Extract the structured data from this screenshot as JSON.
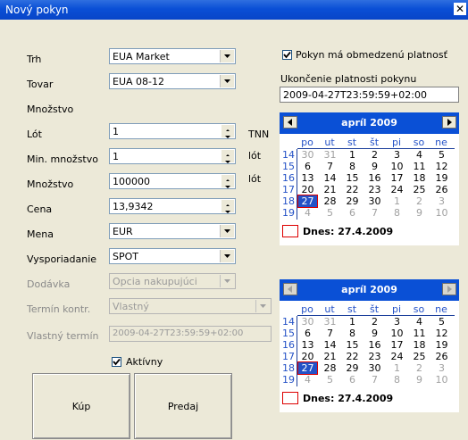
{
  "window": {
    "title": "Nový pokyn",
    "close_glyph": "✕"
  },
  "form": {
    "trh": {
      "label": "Trh",
      "value": "EUA Market"
    },
    "tovar": {
      "label": "Tovar",
      "value": "EUA 08-12"
    },
    "mnozstvo_header": "Množstvo",
    "lot": {
      "label": "Lót",
      "value": "1",
      "unit": "TNN"
    },
    "min_mnozstvo": {
      "label": "Min. množstvo",
      "value": "1",
      "unit": "lót"
    },
    "mnozstvo": {
      "label": "Množstvo",
      "value": "100000",
      "unit": "lót"
    },
    "cena": {
      "label": "Cena",
      "value": "13,9342"
    },
    "mena": {
      "label": "Mena",
      "value": "EUR"
    },
    "vysporiadanie": {
      "label": "Vysporiadanie",
      "value": "SPOT"
    },
    "dodavka": {
      "label": "Dodávka",
      "value": "Opcia nakupujúci"
    },
    "termin_kontr": {
      "label": "Termín kontr.",
      "value": "Vlastný"
    },
    "vlastny_termin": {
      "label": "Vlastný termín",
      "value": "2009-04-27T23:59:59+02:00"
    },
    "aktivny": {
      "label": "Aktívny",
      "checked": true
    }
  },
  "buttons": {
    "buy": "Kúp",
    "sell": "Predaj"
  },
  "validity": {
    "checkbox_label": "Pokyn má obmedzenú platnosť",
    "checked": true,
    "end_label": "Ukončenie platnosti pokynu",
    "end_value": "2009-04-27T23:59:59+02:00"
  },
  "calendar": {
    "month_label": "apríl 2009",
    "prev_glyph": "◀",
    "next_glyph": "▶",
    "dow": [
      "po",
      "ut",
      "st",
      "št",
      "pi",
      "so",
      "ne"
    ],
    "weeks": [
      "14",
      "15",
      "16",
      "17",
      "18",
      "19"
    ],
    "days": [
      [
        "30",
        "31",
        "1",
        "2",
        "3",
        "4",
        "5"
      ],
      [
        "6",
        "7",
        "8",
        "9",
        "10",
        "11",
        "12"
      ],
      [
        "13",
        "14",
        "15",
        "16",
        "17",
        "18",
        "19"
      ],
      [
        "20",
        "21",
        "22",
        "23",
        "24",
        "25",
        "26"
      ],
      [
        "27",
        "28",
        "29",
        "30",
        "1",
        "2",
        "3"
      ],
      [
        "4",
        "5",
        "6",
        "7",
        "8",
        "9",
        "10"
      ]
    ],
    "today_label": "Dnes: 27.4.2009"
  },
  "colors": {
    "title_bar": "#0a4fd6",
    "calendar_header": "#0a50d6",
    "selection": "#2452c7",
    "today_outline": "#dd0000"
  }
}
